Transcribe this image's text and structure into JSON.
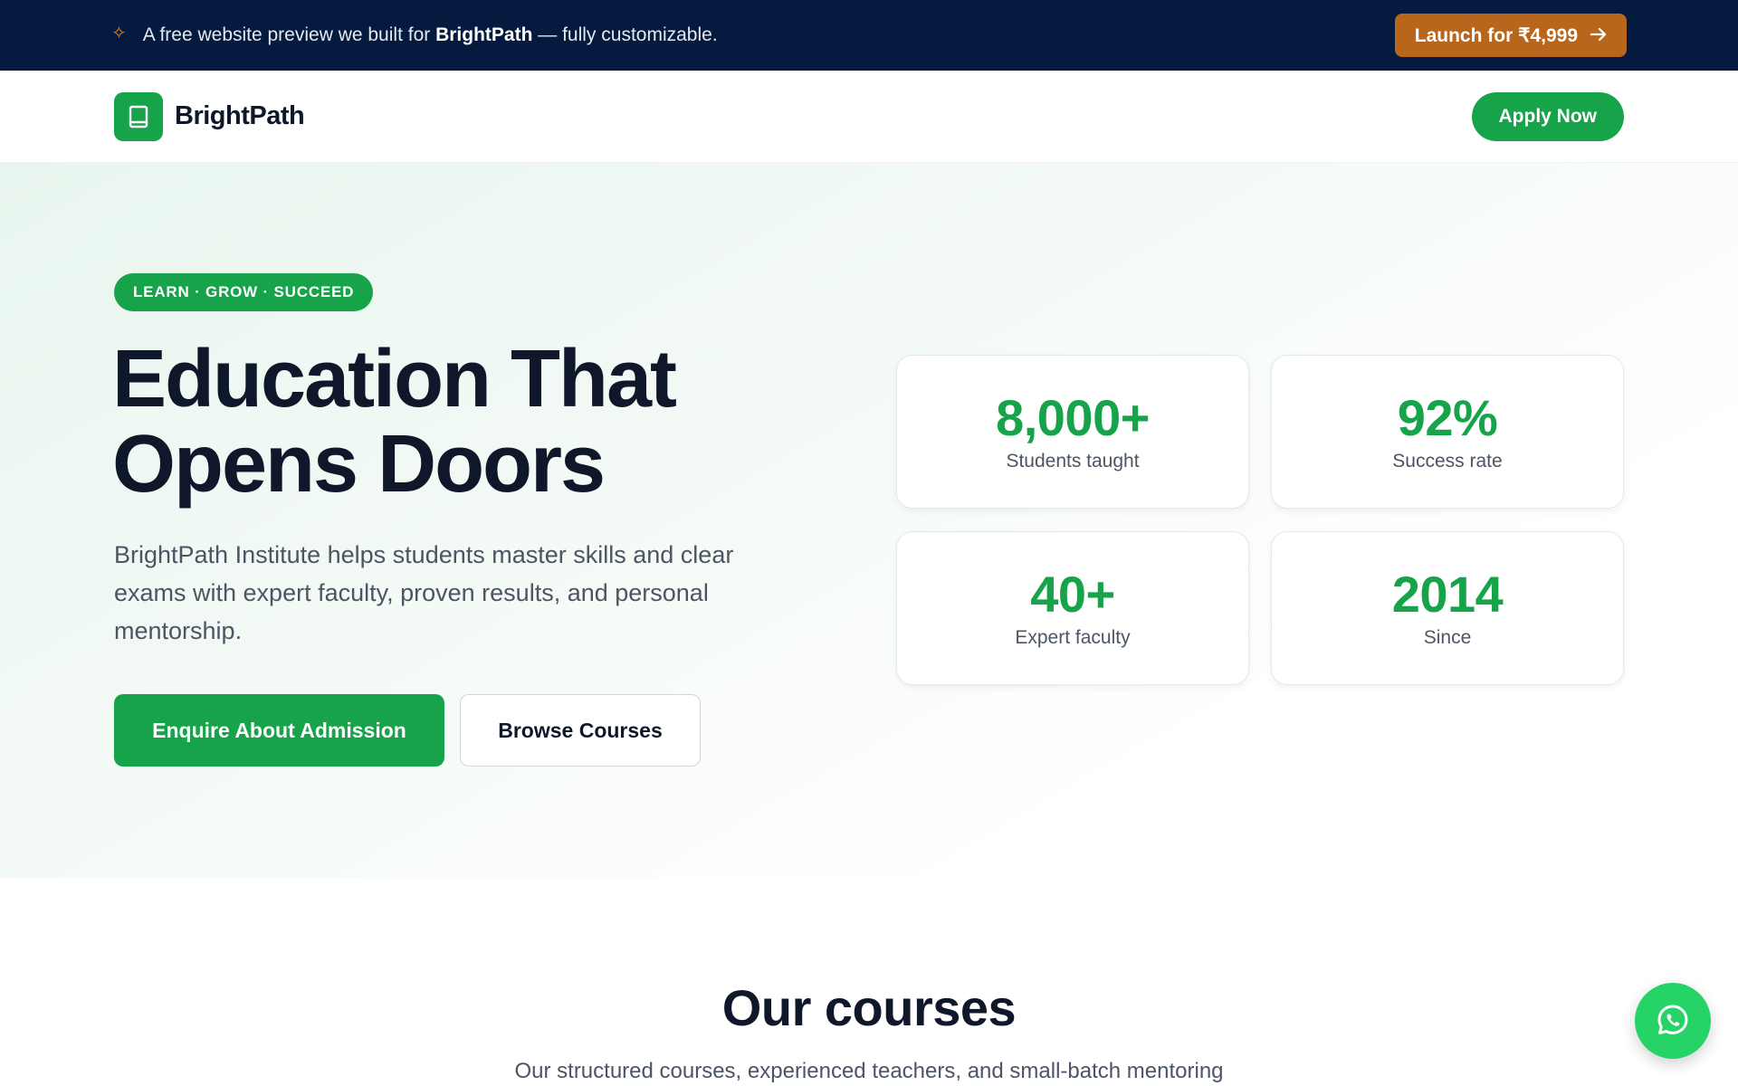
{
  "promo": {
    "text_before": "A free website preview we built for ",
    "brand": "BrightPath",
    "text_after": " — fully customizable.",
    "cta_label": "Launch for ₹4,999",
    "cta_icon": "arrow-right-icon",
    "sparkle_icon": "sparkle-icon",
    "accent": "#b8661c",
    "background": "#041a3f"
  },
  "header": {
    "brand_name": "BrightPath",
    "logo_icon": "book-icon",
    "apply_label": "Apply Now"
  },
  "hero": {
    "tagline": "LEARN · GROW · SUCCEED",
    "title_line1": "Education That",
    "title_line2": "Opens Doors",
    "subtitle": "BrightPath Institute helps students master skills and clear exams with expert faculty, proven results, and personal mentorship.",
    "primary_cta": "Enquire About Admission",
    "secondary_cta": "Browse Courses"
  },
  "stats": [
    {
      "value": "8,000+",
      "label": "Students taught"
    },
    {
      "value": "92%",
      "label": "Success rate"
    },
    {
      "value": "40+",
      "label": "Expert faculty"
    },
    {
      "value": "2014",
      "label": "Since"
    }
  ],
  "courses": {
    "title": "Our courses",
    "subtitle": "Our structured courses, experienced teachers, and small-batch mentoring"
  },
  "floating": {
    "whatsapp_icon": "whatsapp-icon"
  },
  "colors": {
    "brand_green": "#16a34a",
    "whatsapp_green": "#25d366",
    "text_dark": "#0f172a"
  }
}
